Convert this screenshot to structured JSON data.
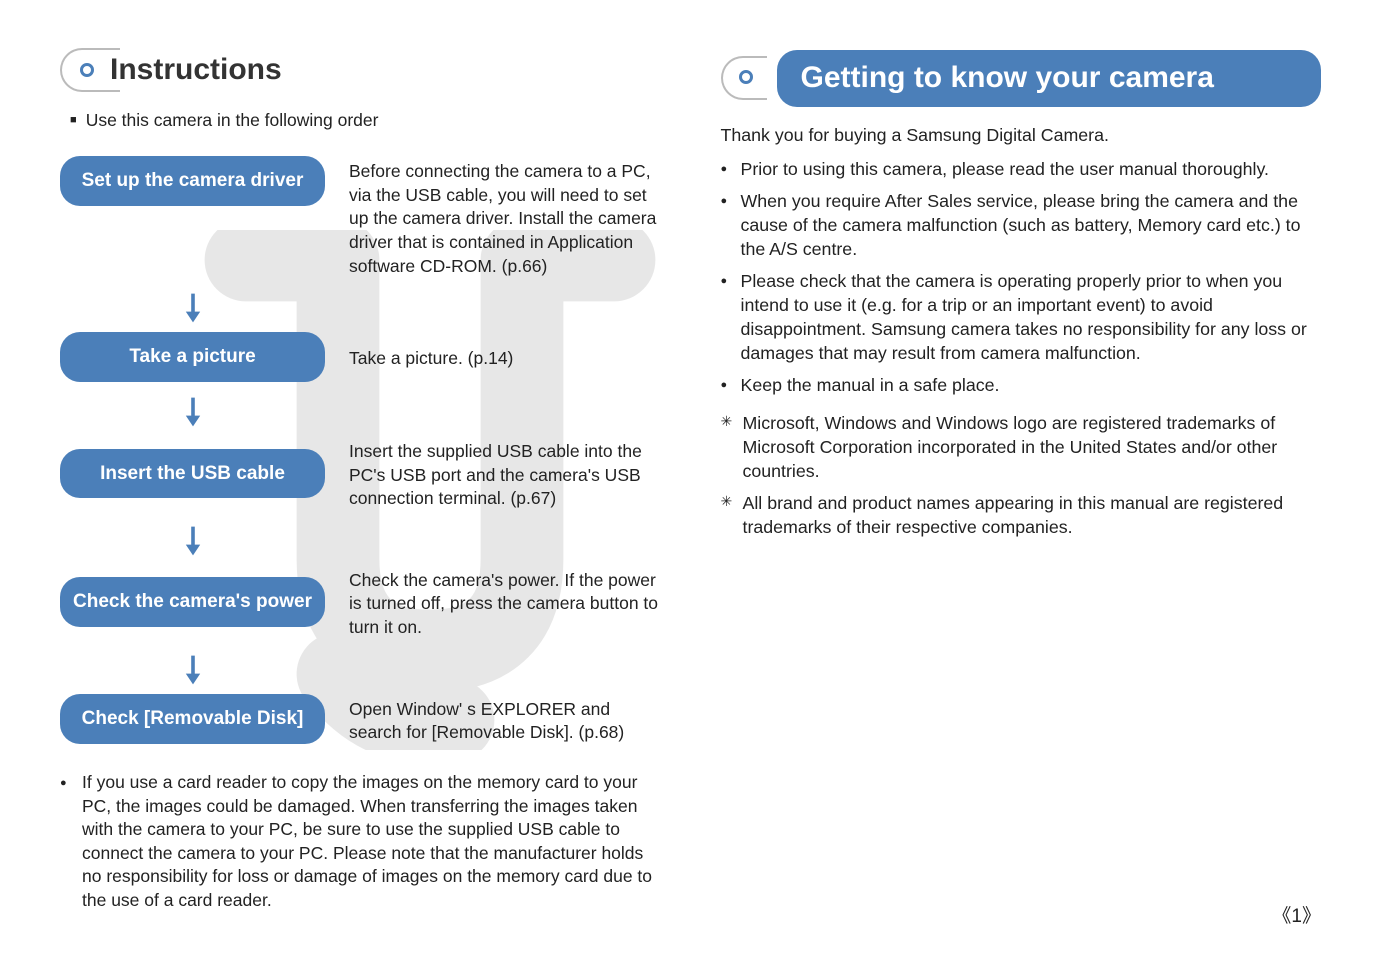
{
  "left": {
    "title": "Instructions",
    "intro": "Use this camera in the following order",
    "steps": [
      {
        "label": "Set up the camera driver",
        "desc": "Before connecting the camera to a PC, via the USB cable, you will need to set up the camera driver. Install the camera driver that is contained in Application software CD-ROM. (p.66)"
      },
      {
        "label": "Take a picture",
        "desc": "Take a picture.  (p.14)"
      },
      {
        "label": "Insert the USB cable",
        "desc": "Insert the supplied USB cable into the PC's USB port and the camera's USB connection terminal. (p.67)"
      },
      {
        "label": "Check the camera's power",
        "desc": "Check the camera's power. If the power is turned off, press the camera button to turn it on."
      },
      {
        "label": "Check [Removable Disk]",
        "desc": "Open Window' s EXPLORER and search for [Removable Disk]. (p.68)"
      }
    ],
    "footnote": "If you use a card reader to copy the images on the memory card to your PC, the images could be damaged. When transferring the images taken with the camera to your PC, be sure to use the supplied USB cable to connect the camera to your PC. Please note that the manufacturer holds no responsibility for loss or damage of images on the memory card due to the use of a card reader."
  },
  "right": {
    "title": "Getting to know your camera",
    "intro": "Thank you for buying a Samsung Digital Camera.",
    "bullets": [
      "Prior to using this camera, please read the user manual thoroughly.",
      "When you require After Sales service, please bring the camera and the cause of the camera malfunction (such as battery, Memory card etc.) to the A/S centre.",
      "Please check that the camera is operating properly prior to when you intend to use it (e.g. for a trip or an important event) to avoid disappointment. Samsung camera takes no responsibility for any loss or damages that may result from camera malfunction.",
      "Keep the manual in a safe place."
    ],
    "stars": [
      "Microsoft, Windows and Windows logo are registered trademarks of Microsoft Corporation incorporated in the United States and/or other countries.",
      "All brand and product names appearing in this manual are registered trademarks of their respective companies."
    ]
  },
  "page": "《1》"
}
